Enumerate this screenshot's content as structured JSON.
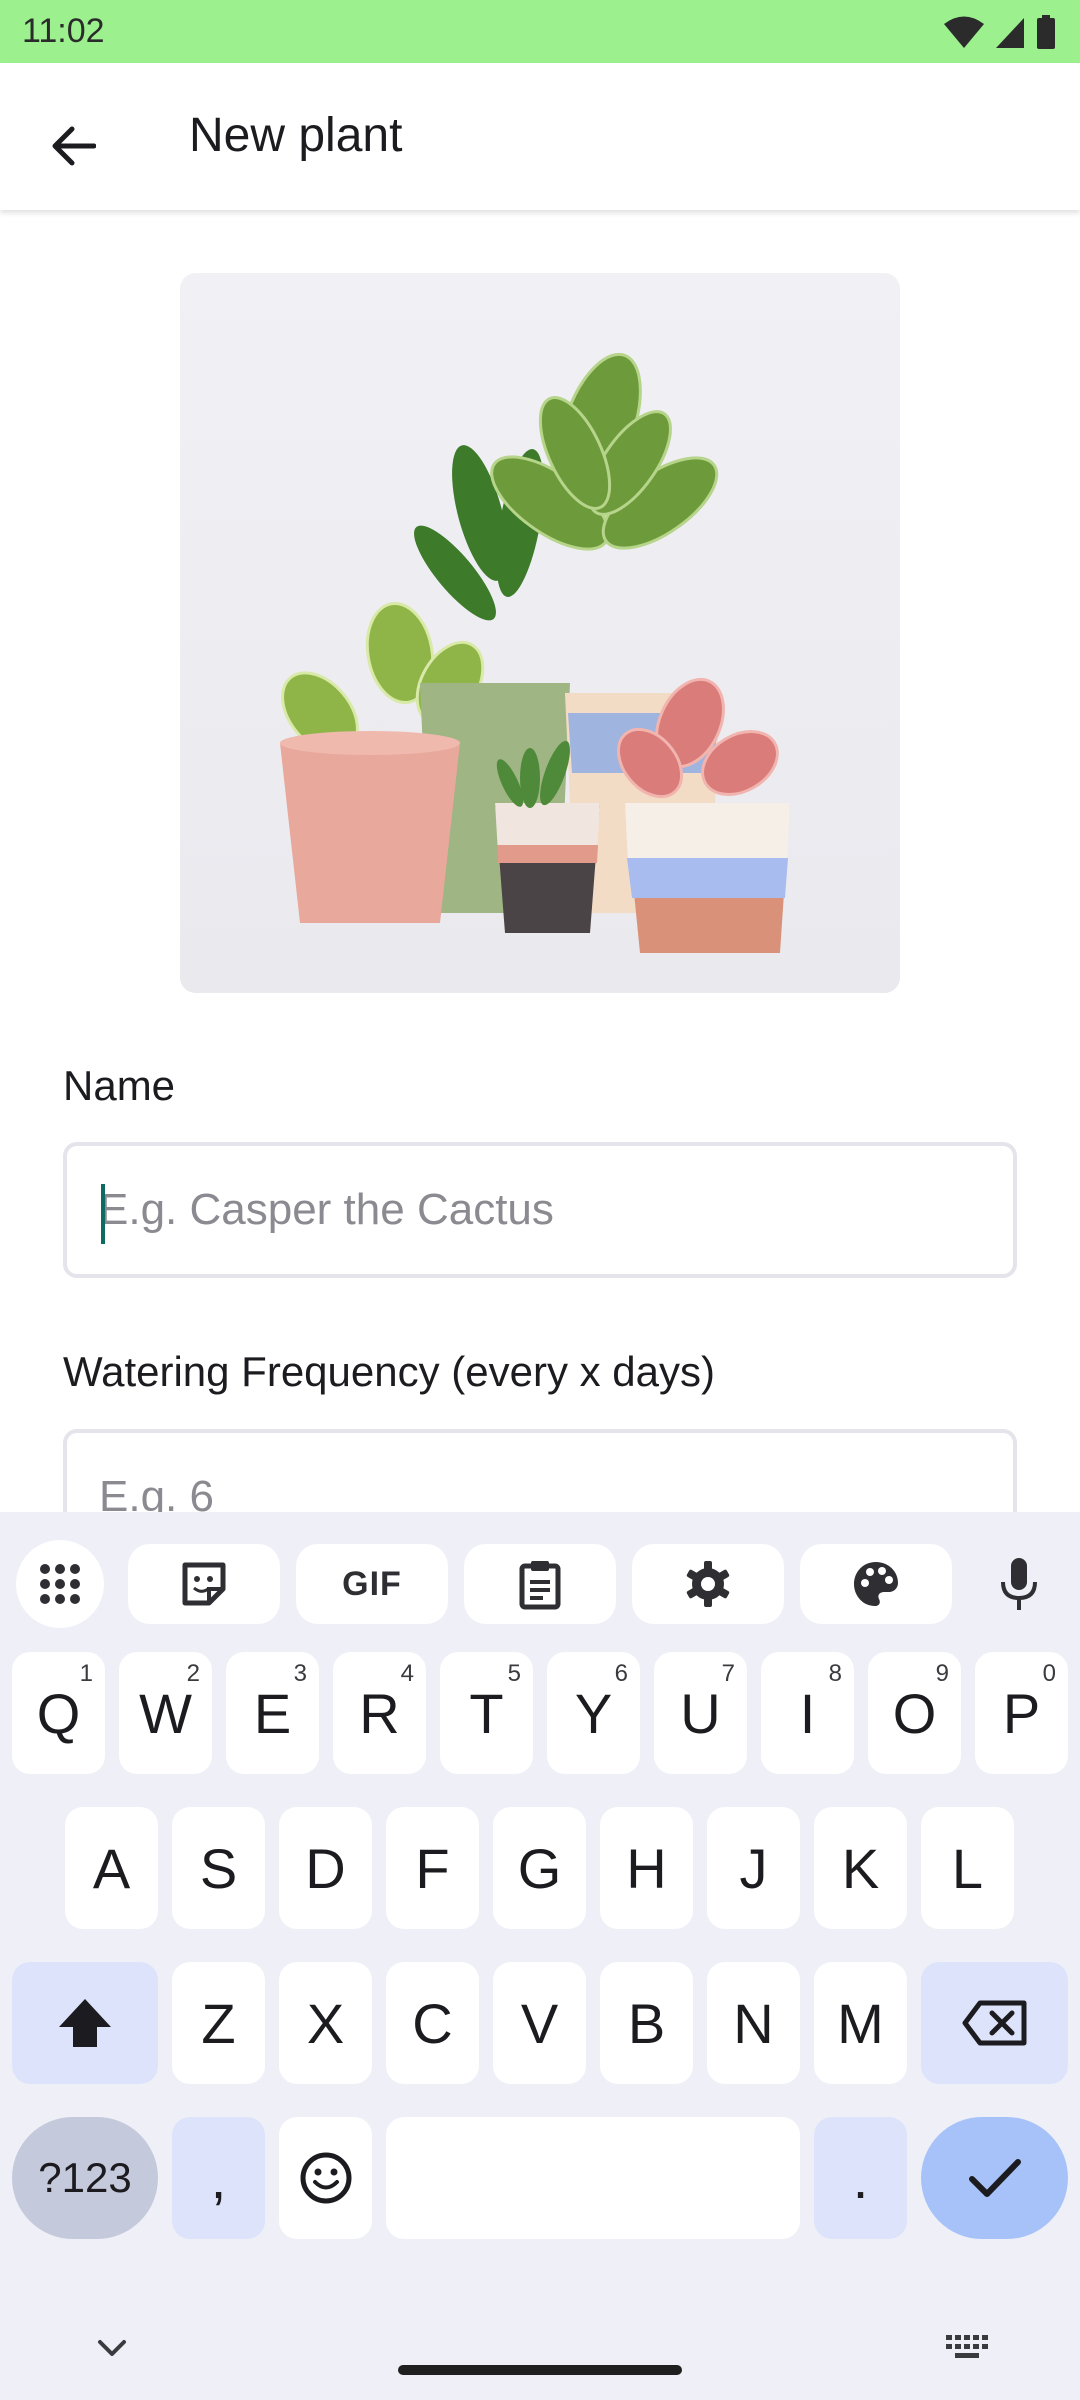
{
  "status_bar": {
    "time": "11:02",
    "icons": [
      "wifi-icon",
      "signal-icon",
      "battery-icon"
    ]
  },
  "app_bar": {
    "title": "New plant",
    "back_icon": "arrow-back-icon"
  },
  "form": {
    "name_label": "Name",
    "name_placeholder": "E.g. Casper the Cactus",
    "name_value": "",
    "watering_label": "Watering Frequency (every x days)",
    "watering_placeholder": "E.g. 6"
  },
  "keyboard": {
    "toolbar": [
      "apps-grid-icon",
      "sticker-icon",
      "GIF",
      "clipboard-icon",
      "gear-icon",
      "palette-icon",
      "mic-icon"
    ],
    "row1": [
      {
        "key": "Q",
        "hint": "1"
      },
      {
        "key": "W",
        "hint": "2"
      },
      {
        "key": "E",
        "hint": "3"
      },
      {
        "key": "R",
        "hint": "4"
      },
      {
        "key": "T",
        "hint": "5"
      },
      {
        "key": "Y",
        "hint": "6"
      },
      {
        "key": "U",
        "hint": "7"
      },
      {
        "key": "I",
        "hint": "8"
      },
      {
        "key": "O",
        "hint": "9"
      },
      {
        "key": "P",
        "hint": "0"
      }
    ],
    "row2": [
      "A",
      "S",
      "D",
      "F",
      "G",
      "H",
      "J",
      "K",
      "L"
    ],
    "row3": [
      "Z",
      "X",
      "C",
      "V",
      "B",
      "N",
      "M"
    ],
    "symbols_label": "?123",
    "comma": ",",
    "period": "."
  },
  "colors": {
    "status_bar": "#9cf08e",
    "caret": "#0e6b61",
    "enter_key": "#a7c2f8",
    "mod_key": "#dde3fb"
  }
}
